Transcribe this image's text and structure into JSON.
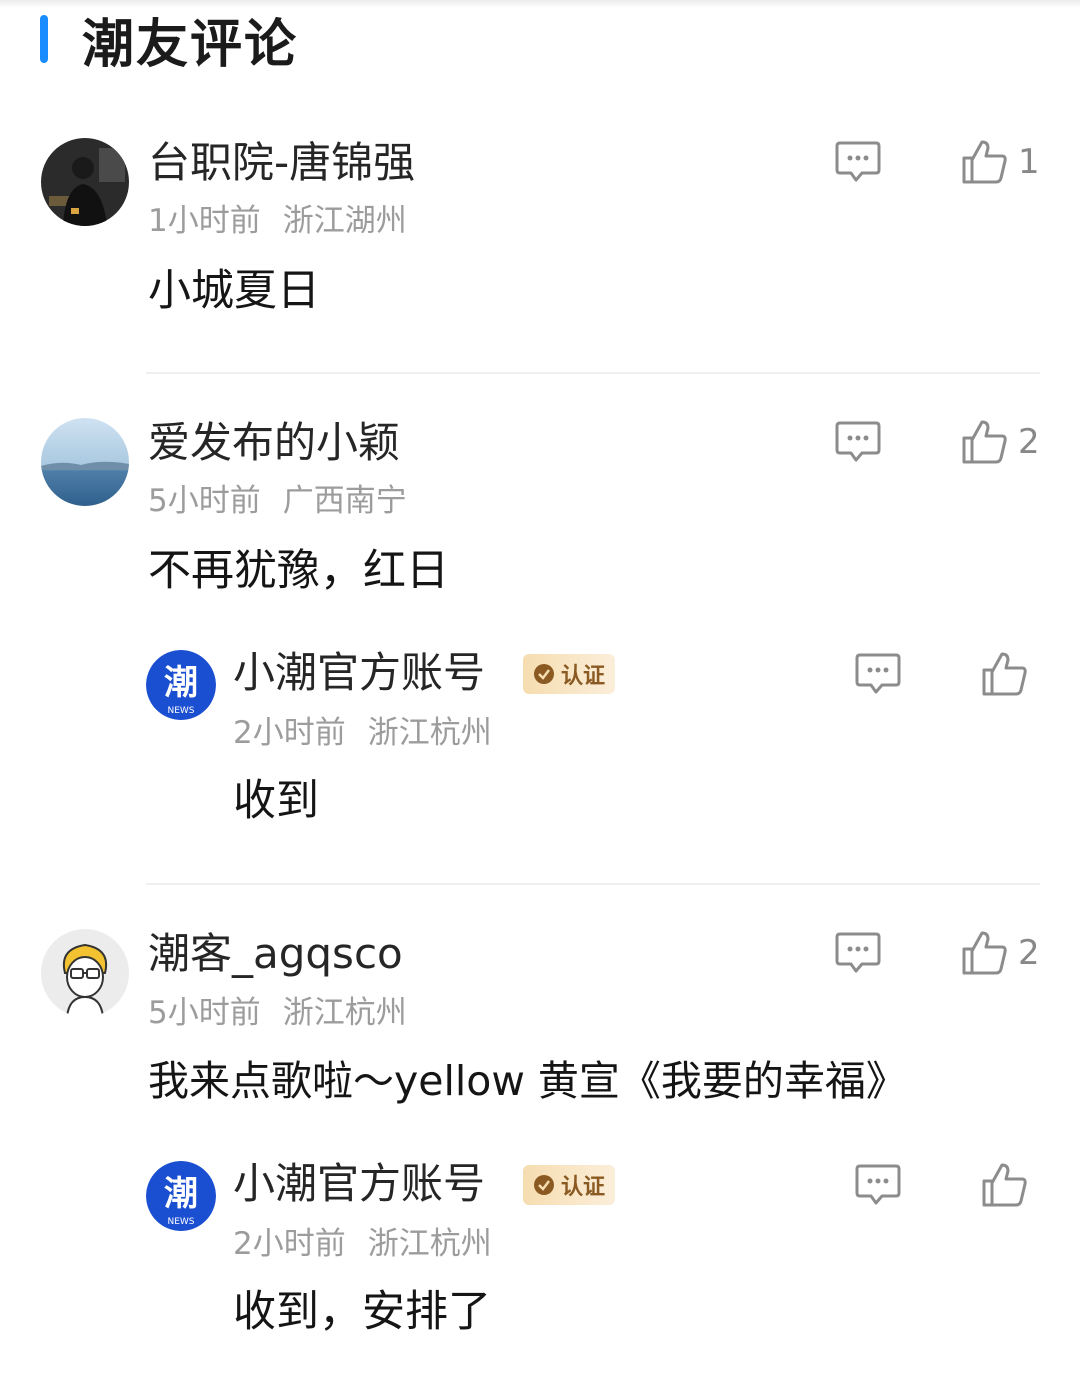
{
  "section": {
    "title": "潮友评论"
  },
  "comments": [
    {
      "username": "台职院-唐锦强",
      "time": "1小时前",
      "location": "浙江湖州",
      "text": "小城夏日",
      "likes": "1",
      "avatar": "photo-avatar-dark"
    },
    {
      "username": "爱发布的小颖",
      "time": "5小时前",
      "location": "广西南宁",
      "text": "不再犹豫，红日",
      "likes": "2",
      "avatar": "photo-avatar-sea",
      "reply": {
        "username": "小潮官方账号",
        "badge": "认证",
        "time": "2小时前",
        "location": "浙江杭州",
        "text": "收到",
        "avatar_glyph": "潮",
        "avatar_sub": "NEWS"
      }
    },
    {
      "username": "潮客_agqsco",
      "time": "5小时前",
      "location": "浙江杭州",
      "text": "我来点歌啦～yellow 黄宣《我要的幸福》",
      "likes": "2",
      "avatar": "cartoon-avatar",
      "reply": {
        "username": "小潮官方账号",
        "badge": "认证",
        "time": "2小时前",
        "location": "浙江杭州",
        "text": "收到，安排了",
        "avatar_glyph": "潮",
        "avatar_sub": "NEWS"
      }
    }
  ],
  "colors": {
    "accent": "#1a8cff",
    "badge_bg": "#f6ddb0",
    "meta_gray": "#9c9c9c"
  }
}
